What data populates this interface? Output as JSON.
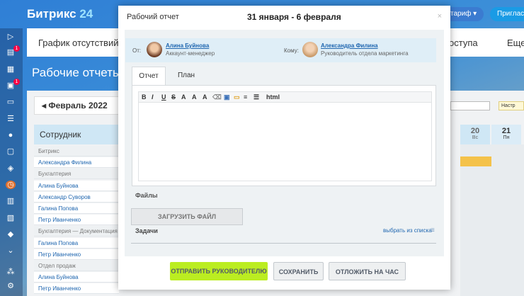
{
  "brand": {
    "name": "Битрикс",
    "num": "24"
  },
  "top_buttons": {
    "tariff": "тариф",
    "invite": "Приглас"
  },
  "nav": {
    "absence": "График отсутствий",
    "access": "оступа",
    "more": "Еще"
  },
  "page": {
    "title": "Рабочие отчеты",
    "month": "Февраль 2022",
    "settings": "Настр"
  },
  "sidebar_badges": [
    "1",
    "1"
  ],
  "table": {
    "header": "Сотрудник",
    "days": [
      {
        "num": "20",
        "dow": "Вс"
      },
      {
        "num": "21",
        "dow": "Пн"
      }
    ],
    "rows": [
      {
        "text": "Битрикс",
        "type": "grp"
      },
      {
        "text": "Александра Филина",
        "type": "lnk"
      },
      {
        "text": "Бухгалтерия",
        "type": "grp"
      },
      {
        "text": "Алина Буйнова",
        "type": "lnk"
      },
      {
        "text": "Александр Суворов",
        "type": "lnk"
      },
      {
        "text": "Галина Попова",
        "type": "lnk"
      },
      {
        "text": "Петр Иванченко",
        "type": "lnk"
      },
      {
        "text": "Бухгалтерия — Документация",
        "type": "grp"
      },
      {
        "text": "Галина Попова",
        "type": "lnk"
      },
      {
        "text": "Петр Иванченко",
        "type": "lnk"
      },
      {
        "text": "Отдел продаж",
        "type": "grp"
      },
      {
        "text": "Алина Буйнова",
        "type": "lnk"
      },
      {
        "text": "Петр Иванченко",
        "type": "lnk"
      }
    ]
  },
  "modal": {
    "title": "Рабочий отчет",
    "period": "31 января - 6 февраля",
    "close": "×",
    "from_label": "От:",
    "from_name": "Алина Буйнова",
    "from_role": "Аккаунт-менеджер",
    "to_label": "Кому:",
    "to_name": "Александра Филина",
    "to_role": "Руководитель отдела маркетинга",
    "tabs": [
      "Отчет",
      "План"
    ],
    "toolbar": [
      "B",
      "I",
      "U",
      "S",
      "html"
    ],
    "files_label": "Файлы",
    "upload_label": "ЗАГРУЗИТЬ ФАЙЛ",
    "tasks_label": "Задачи",
    "tasks_pick": "выбрать из списка",
    "buttons": {
      "send": "ОТПРАВИТЬ РУКОВОДИТЕЛЮ",
      "save": "СОХРАНИТЬ",
      "later": "ОТЛОЖИТЬ НА ЧАС"
    }
  },
  "colors": {
    "accent": "#bbed21",
    "link": "#2067b0",
    "header": "#cfe7f5"
  }
}
